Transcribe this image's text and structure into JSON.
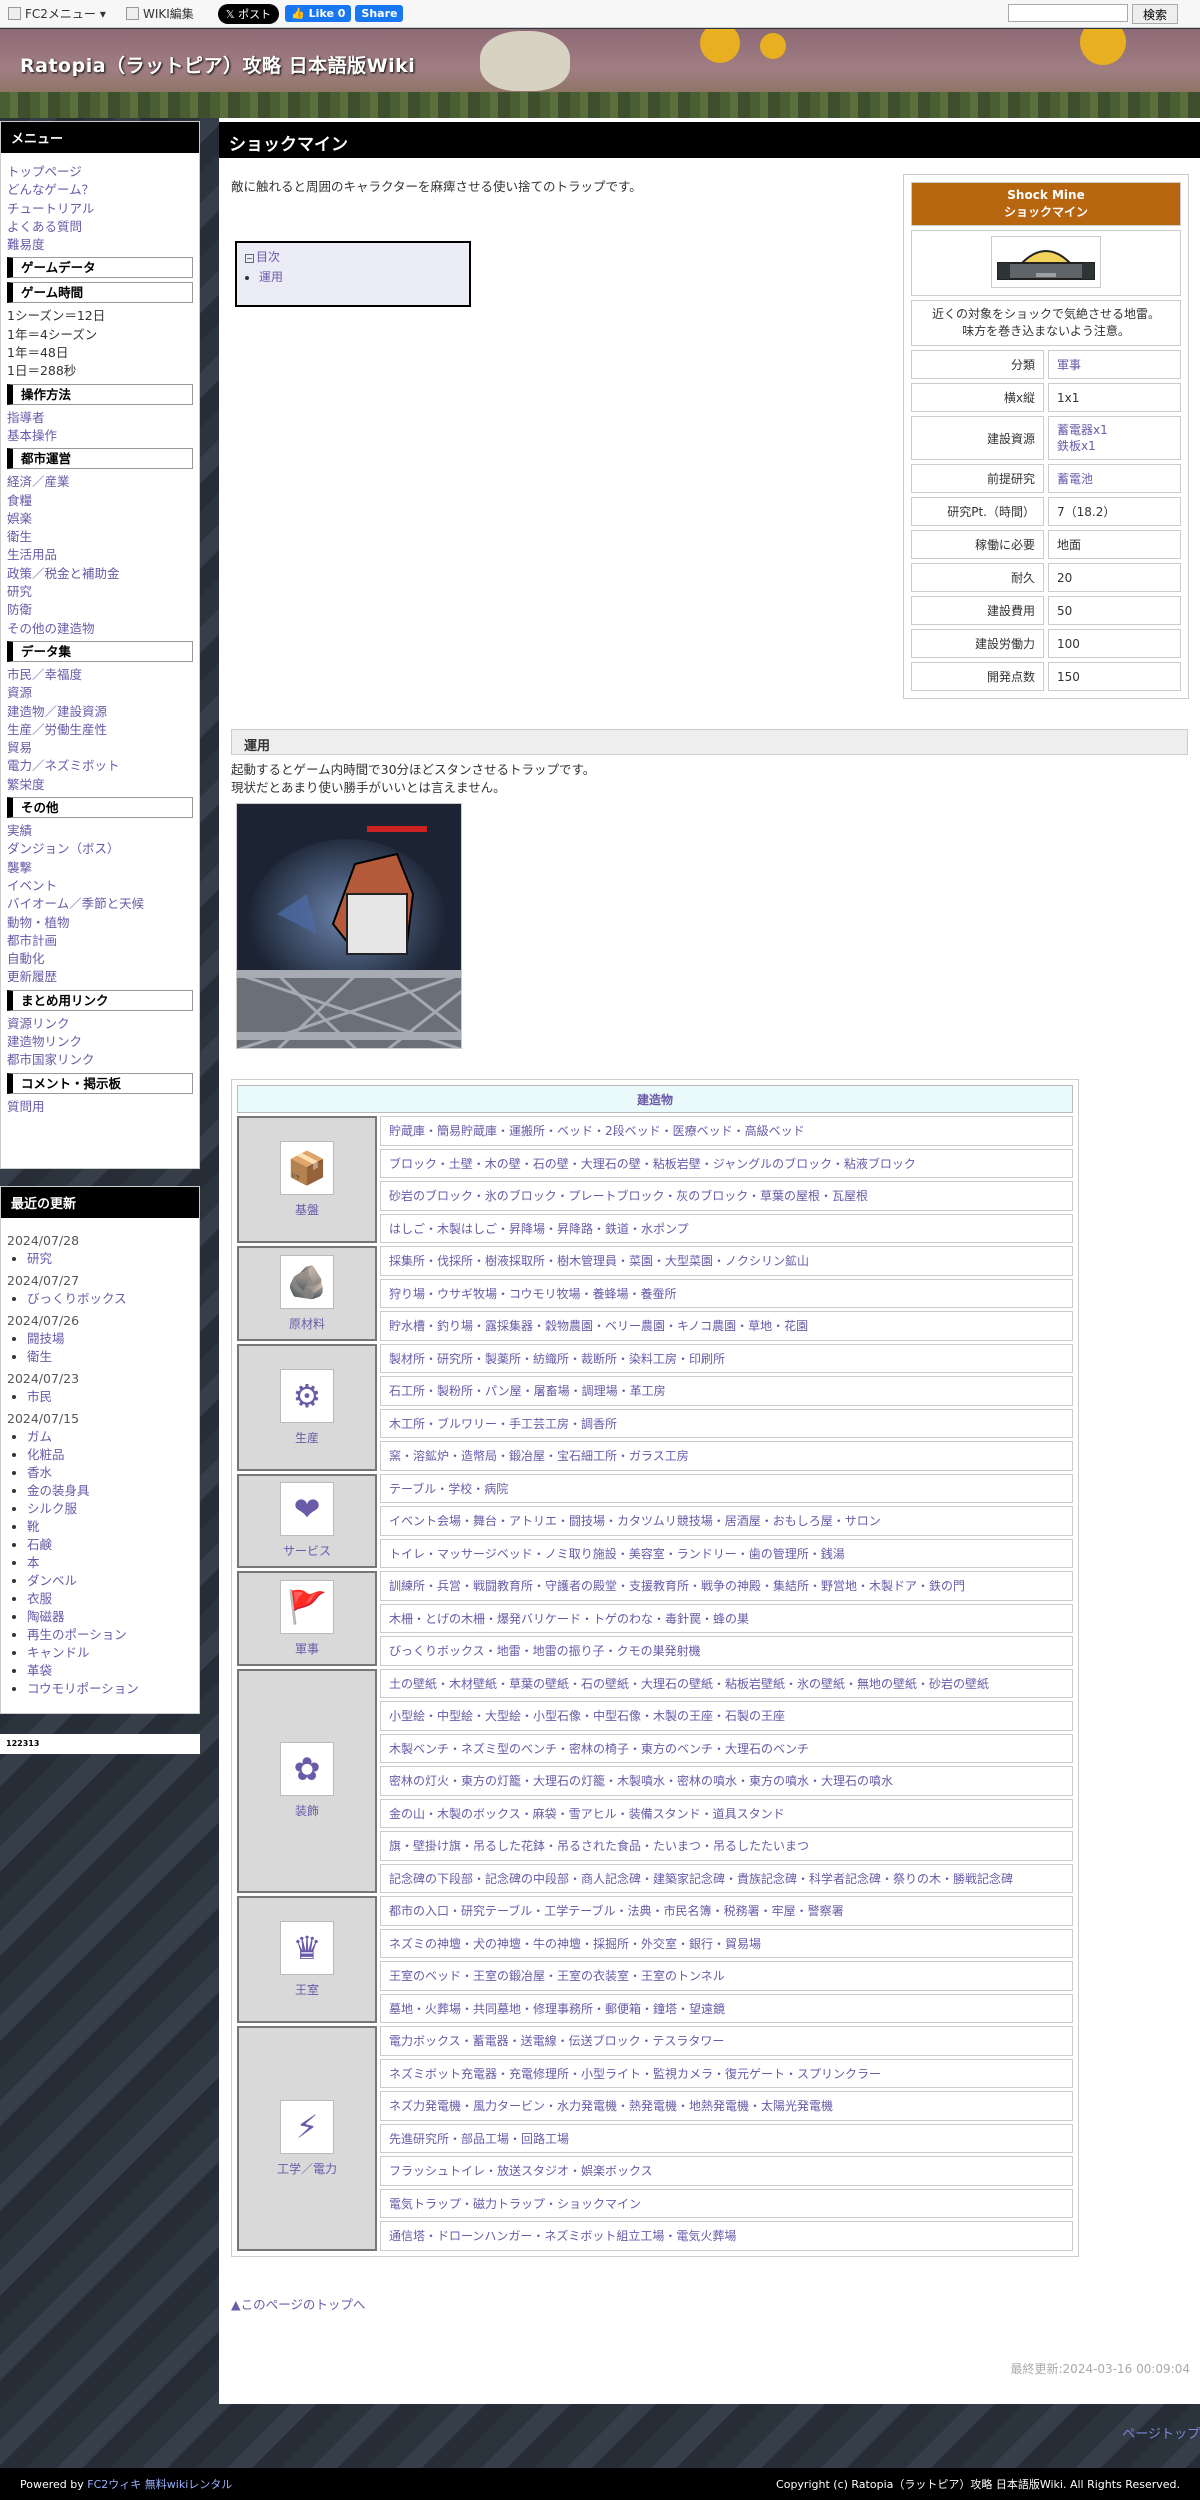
{
  "topbar": {
    "fc2menu": "FC2メニュー",
    "wiki_edit": "WIKI編集",
    "post": "𝕏 ポスト",
    "like": "👍 Like 0",
    "share": "Share",
    "search_button": "検索"
  },
  "header": {
    "title": "Ratopia（ラットピア）攻略 日本語版Wiki"
  },
  "sidebar": {
    "menu_title": "メニュー",
    "top_links": [
      "トップページ",
      "どんなゲーム？",
      "チュートリアル",
      "よくある質問",
      "難易度"
    ],
    "sections": [
      {
        "title": "ゲームデータ",
        "items": []
      },
      {
        "title": "ゲーム時間",
        "items": [],
        "texts": [
          "1シーズン＝12日",
          "1年＝4シーズン",
          "1年＝48日",
          "1日＝288秒"
        ]
      },
      {
        "title": "操作方法",
        "items": [
          "指導者",
          "基本操作"
        ]
      },
      {
        "title": "都市運営",
        "items": [
          "経済／産業",
          "食糧",
          "娯楽",
          "衛生",
          "生活用品",
          "政策／税金と補助金",
          "研究",
          "防衛",
          "その他の建造物"
        ]
      },
      {
        "title": "データ集",
        "items": [
          "市民／幸福度",
          "資源",
          "建造物／建設資源",
          "生産／労働生産性",
          "貿易",
          "電力／ネズミボット",
          "繁栄度"
        ]
      },
      {
        "title": "その他",
        "items": [
          "実績",
          "ダンジョン（ボス）",
          "襲撃",
          "イベント",
          "バイオーム／季節と天候",
          "動物・植物",
          "都市計画",
          "自動化",
          "更新履歴"
        ]
      },
      {
        "title": "まとめ用リンク",
        "items": [
          "資源リンク",
          "建造物リンク",
          "都市国家リンク"
        ]
      },
      {
        "title": "コメント・掲示板",
        "items": [
          "質問用"
        ]
      }
    ],
    "updates_title": "最近の更新",
    "updates": [
      {
        "date": "2024/07/28",
        "items": [
          "研究"
        ]
      },
      {
        "date": "2024/07/27",
        "items": [
          "びっくりボックス"
        ]
      },
      {
        "date": "2024/07/26",
        "items": [
          "闘技場",
          "衛生"
        ]
      },
      {
        "date": "2024/07/23",
        "items": [
          "市民"
        ]
      },
      {
        "date": "2024/07/15",
        "items": [
          "ガム",
          "化粧品",
          "香水",
          "金の装身具",
          "シルク服",
          "靴",
          "石鹸",
          "本",
          "ダンベル",
          "衣服",
          "陶磁器",
          "再生のポーション",
          "キャンドル",
          "革袋",
          "コウモリポーション"
        ]
      }
    ],
    "counter": "122313"
  },
  "main": {
    "page_title": "ショックマイン",
    "intro": "敵に触れると周囲のキャラクターを麻痺させる使い捨てのトラップです。",
    "toc": {
      "title": "目次",
      "items": [
        "運用"
      ]
    },
    "infobox": {
      "name_en": "Shock Mine",
      "name_ja": "ショックマイン",
      "desc_line1": "近くの対象をショックで気絶させる地雷。",
      "desc_line2": "味方を巻き込まないよう注意。",
      "rows": [
        {
          "label": "分類",
          "value": "軍事",
          "link": true
        },
        {
          "label": "横x縦",
          "value": "1x1",
          "link": false
        },
        {
          "label": "建設資源",
          "value": "蓄電器x1\n鉄板x1",
          "link": true
        },
        {
          "label": "前提研究",
          "value": "蓄電池",
          "link": true
        },
        {
          "label": "研究Pt.（時間）",
          "value": "7（18.2）",
          "link": false
        },
        {
          "label": "稼働に必要",
          "value": "地面",
          "link": false
        },
        {
          "label": "耐久",
          "value": "20",
          "link": false
        },
        {
          "label": "建設費用",
          "value": "50",
          "link": false
        },
        {
          "label": "建設労働力",
          "value": "100",
          "link": false
        },
        {
          "label": "開発点数",
          "value": "150",
          "link": false
        }
      ]
    },
    "section_title": "運用",
    "section_text1": "起動するとゲーム内時間で30分ほどスタンさせるトラップです。",
    "section_text2": "現状だとあまり使い勝手がいいとは言えません。",
    "nav": {
      "title": "建造物",
      "groups": [
        {
          "name": "基盤",
          "icon": "crate-icon",
          "glyph": "📦",
          "rows": [
            "貯蔵庫・簡易貯蔵庫・運搬所・ベッド・2段ベッド・医療ベッド・高級ベッド",
            "ブロック・土壁・木の壁・石の壁・大理石の壁・粘板岩壁・ジャングルのブロック・粘液ブロック",
            "砂岩のブロック・氷のブロック・プレートブロック・灰のブロック・草葉の屋根・瓦屋根",
            "はしご・木製はしご・昇降場・昇降路・鉄道・水ポンプ"
          ]
        },
        {
          "name": "原材料",
          "icon": "ore-icon",
          "glyph": "🪨",
          "rows": [
            "採集所・伐採所・樹液採取所・樹木管理員・菜園・大型菜園・ノクシリン鉱山",
            "狩り場・ウサギ牧場・コウモリ牧場・養蜂場・養蚕所",
            "貯水槽・釣り場・露採集器・穀物農園・ベリー農園・キノコ農園・草地・花園"
          ]
        },
        {
          "name": "生産",
          "icon": "gears-icon",
          "glyph": "⚙",
          "rows": [
            "製材所・研究所・製薬所・紡織所・裁断所・染料工房・印刷所",
            "石工所・製粉所・パン屋・屠畜場・調理場・革工房",
            "木工所・ブルワリー・手工芸工房・調香所",
            "窯・溶鉱炉・造幣局・鍛冶屋・宝石細工所・ガラス工房"
          ]
        },
        {
          "name": "サービス",
          "icon": "heart-icon",
          "glyph": "❤",
          "rows": [
            "テーブル・学校・病院",
            "イベント会場・舞台・アトリエ・闘技場・カタツムリ競技場・居酒屋・おもしろ屋・サロン",
            "トイレ・マッサージベッド・ノミ取り施設・美容室・ランドリー・歯の管理所・銭湯"
          ]
        },
        {
          "name": "軍事",
          "icon": "flag-icon",
          "glyph": "🚩",
          "rows": [
            "訓練所・兵営・戦闘教育所・守護者の殿堂・支援教育所・戦争の神殿・集結所・野営地・木製ドア・鉄の門",
            "木柵・とげの木柵・爆発バリケード・トゲのわな・毒針罠・蜂の巣",
            "びっくりボックス・地雷・地雷の振り子・クモの巣発射機"
          ]
        },
        {
          "name": "装飾",
          "icon": "flower-icon",
          "glyph": "✿",
          "rows": [
            "土の壁紙・木材壁紙・草葉の壁紙・石の壁紙・大理石の壁紙・粘板岩壁紙・氷の壁紙・無地の壁紙・砂岩の壁紙",
            "小型絵・中型絵・大型絵・小型石像・中型石像・木製の王座・石製の王座",
            "木製ベンチ・ネズミ型のベンチ・密林の椅子・東方のベンチ・大理石のベンチ",
            "密林の灯火・東方の灯籠・大理石の灯籠・木製噴水・密林の噴水・東方の噴水・大理石の噴水",
            "金の山・木製のボックス・麻袋・雪アヒル・装備スタンド・道具スタンド",
            "旗・壁掛け旗・吊るした花鉢・吊るされた食品・たいまつ・吊るしたたいまつ",
            "記念碑の下段部・記念碑の中段部・商人記念碑・建築家記念碑・貴族記念碑・科学者記念碑・祭りの木・勝戦記念碑"
          ]
        },
        {
          "name": "王室",
          "icon": "crown-icon",
          "glyph": "♛",
          "rows": [
            "都市の入口・研究テーブル・工学テーブル・法典・市民名簿・税務署・牢屋・警察署",
            "ネズミの神壇・犬の神壇・牛の神壇・採掘所・外交室・銀行・貿易場",
            "王室のベッド・王室の鍛冶屋・王室の衣装室・王室のトンネル",
            "墓地・火葬場・共同墓地・修理事務所・郵便箱・鐘塔・望遠鏡"
          ]
        },
        {
          "name": "工学／電力",
          "icon": "lightning-icon",
          "glyph": "⚡",
          "rows": [
            "電力ボックス・蓄電器・送電線・伝送ブロック・テスラタワー",
            "ネズミボット充電器・充電修理所・小型ライト・監視カメラ・復元ゲート・スプリンクラー",
            "ネズ力発電機・風力タービン・水力発電機・熱発電機・地熱発電機・太陽光発電機",
            "先進研究所・部品工場・回路工場",
            "フラッシュトイレ・放送スタジオ・娯楽ボックス",
            "電気トラップ・磁力トラップ・ショックマイン",
            "通信塔・ドローンハンガー・ネズミボット組立工場・電気火葬場"
          ]
        }
      ]
    },
    "to_top": "▲このページのトップへ",
    "last_modified": "最終更新:2024-03-16 00:09:04"
  },
  "page_top": "ページトップ",
  "footer": {
    "left_prefix": "Powered by ",
    "left_link": "FC2ウィキ 無料wikiレンタル",
    "right": "Copyright (c) Ratopia（ラットピア）攻略 日本語版Wiki. All Rights Reserved."
  }
}
